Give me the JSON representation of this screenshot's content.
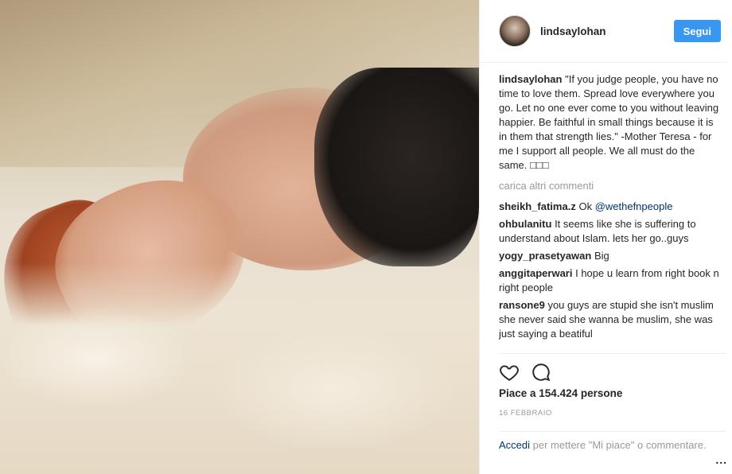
{
  "post": {
    "image_alt": "photo",
    "author": {
      "username": "lindsaylohan"
    },
    "follow_label": "Segui",
    "caption": {
      "author": "lindsaylohan",
      "text": "\"If you judge people, you have no time to love them. Spread love everywhere you go. Let no one ever come to you without leaving happier. Be faithful in small things because it is in them that strength lies.\" -Mother Teresa - for me I support all people. We all must do the same. □□□"
    },
    "load_more_label": "carica altri commenti",
    "comments": [
      {
        "author": "sheikh_fatima.z",
        "text": "Ok ",
        "mention": "@wethefnpeople"
      },
      {
        "author": "ohbulanitu",
        "text": "It seems like she is suffering to understand about Islam. lets her go..guys",
        "mention": ""
      },
      {
        "author": "yogy_prasetyawan",
        "text": "Big",
        "mention": ""
      },
      {
        "author": "anggitaperwari",
        "text": "I hope u learn from right book n right people",
        "mention": ""
      },
      {
        "author": "ransone9",
        "text": "you guys are stupid she isn't muslim she never said she wanna be muslim, she was just saying a beatiful",
        "mention": ""
      }
    ],
    "actions": {
      "like_icon": "heart-icon",
      "comment_icon": "comment-icon"
    },
    "likes_text": "Piace a 154.424 persone",
    "date_text": "16 febbraio",
    "login_prompt": {
      "link_text": "Accedi",
      "rest_text": " per mettere \"Mi piace\" o commentare."
    },
    "more_options_label": "..."
  },
  "colors": {
    "follow_button": "#3897f0",
    "link": "#003569",
    "muted": "#999999"
  }
}
